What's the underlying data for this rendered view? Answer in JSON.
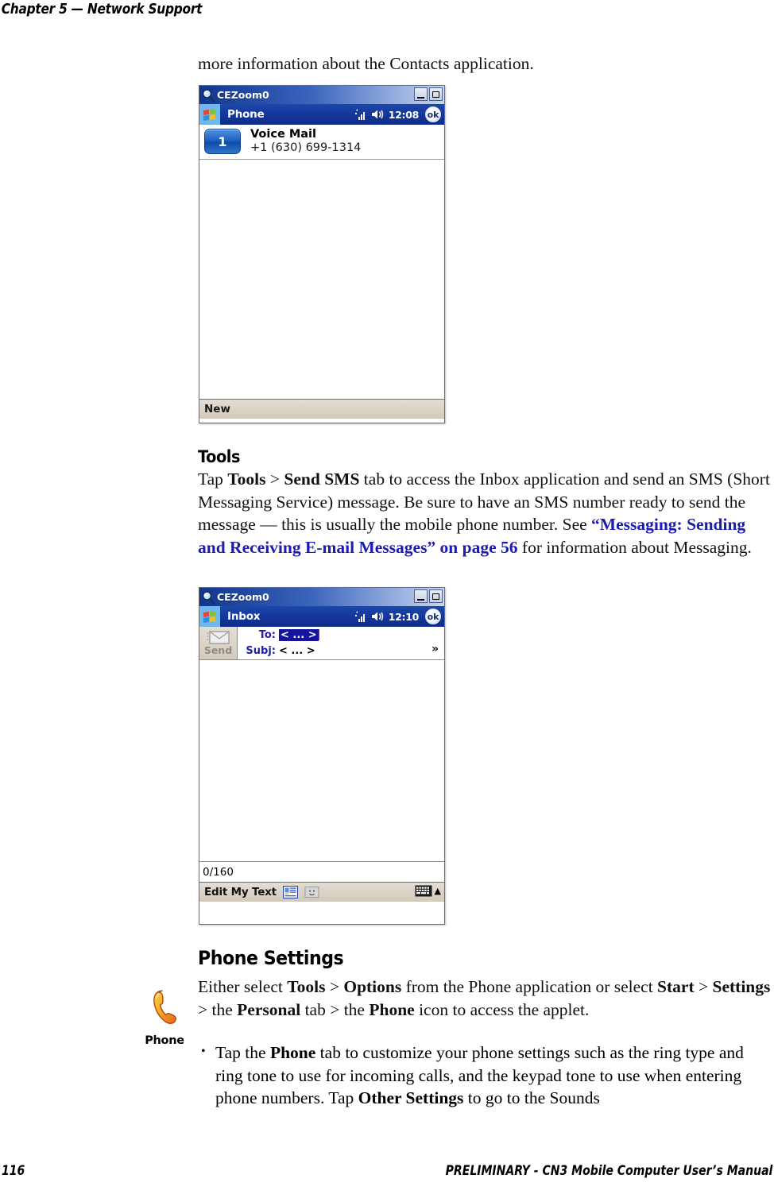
{
  "header": {
    "text": "Chapter 5 — Network Support"
  },
  "intro": {
    "text": "more information about the Contacts application."
  },
  "phone_window": {
    "caption_title": "CEZoom0",
    "caption_icon": "magnifier-icon",
    "minimize_label": "minimize",
    "maximize_label": "maximize",
    "app_title": "Phone",
    "start_icon": "windows-start-icon",
    "signal_icon": "signal-bars-icon",
    "speaker_icon": "speaker-icon",
    "clock": "12:08",
    "ok_label": "ok",
    "speed_dial": {
      "key": "1",
      "name": "Voice Mail",
      "number": "+1 (630) 699-1314"
    },
    "soft_key": "New"
  },
  "tools_section": {
    "heading": "Tools",
    "paragraph_parts": [
      {
        "t": "Tap ",
        "style": "normal"
      },
      {
        "t": "Tools",
        "style": "bold"
      },
      {
        "t": " > ",
        "style": "normal"
      },
      {
        "t": "Send SMS",
        "style": "bold"
      },
      {
        "t": " tab to access the Inbox application and send an SMS (Short Messaging Service) message. Be sure to have an SMS number ready to send the message — this is usually the mobile phone number. See ",
        "style": "normal"
      },
      {
        "t": "“Messaging: Sending and Receiving E-mail Messages” on page 56",
        "style": "link"
      },
      {
        "t": " for information about Messaging.",
        "style": "normal"
      }
    ]
  },
  "inbox_window": {
    "caption_title": "CEZoom0",
    "caption_icon": "magnifier-icon",
    "app_title": "Inbox",
    "clock": "12:10",
    "ok_label": "ok",
    "send_button": {
      "label": "Send",
      "icon": "envelope-icon"
    },
    "fields": [
      {
        "label": "To:",
        "value": "< ... >",
        "selected": true
      },
      {
        "label": "Subj:",
        "value": "< ... >",
        "selected": false
      }
    ],
    "expand_icon": "chevron-double-down-icon",
    "char_count": "0/160",
    "soft_bar": {
      "edit_my_text": "Edit My Text",
      "my_text_icon": "my-text-list-icon",
      "emoticon_icon": "emoticon-icon",
      "sip_icon": "keyboard-icon",
      "sip_arrow_icon": "caret-up-icon"
    }
  },
  "phone_settings_section": {
    "heading": "Phone Settings",
    "margin_icon": {
      "name": "phone-handset-icon",
      "label": "Phone"
    },
    "paragraph_parts": [
      {
        "t": "Either select ",
        "style": "normal"
      },
      {
        "t": "Tools",
        "style": "bold"
      },
      {
        "t": " > ",
        "style": "normal"
      },
      {
        "t": "Options",
        "style": "bold"
      },
      {
        "t": " from the Phone application or select ",
        "style": "normal"
      },
      {
        "t": "Start",
        "style": "bold"
      },
      {
        "t": " > ",
        "style": "normal"
      },
      {
        "t": "Settings",
        "style": "bold"
      },
      {
        "t": " > the ",
        "style": "normal"
      },
      {
        "t": "Personal",
        "style": "bold"
      },
      {
        "t": " tab > the ",
        "style": "normal"
      },
      {
        "t": "Phone",
        "style": "bold"
      },
      {
        "t": " icon to access the applet.",
        "style": "normal"
      }
    ],
    "bullets": [
      [
        {
          "t": "Tap the ",
          "style": "normal"
        },
        {
          "t": "Phone",
          "style": "bold"
        },
        {
          "t": " tab to customize your phone settings such as the ring type and ring tone to use for incoming calls, and the keypad tone to use when entering phone numbers. Tap ",
          "style": "normal"
        },
        {
          "t": "Other Settings",
          "style": "bold"
        },
        {
          "t": " to go to the Sounds",
          "style": "normal"
        }
      ]
    ]
  },
  "footer": {
    "page_number": "116",
    "title": "PRELIMINARY - CN3 Mobile Computer User’s Manual"
  },
  "colors": {
    "link": "#1b1bb0",
    "titlebar_blue": "#16379c",
    "selection_blue": "#14159c",
    "softbar_tan": "#d8cfc1"
  }
}
